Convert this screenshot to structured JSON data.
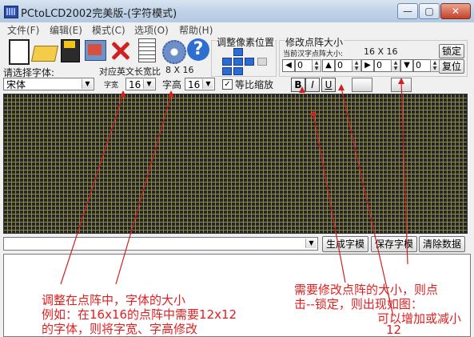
{
  "window": {
    "title": "PCtoLCD2002完美版-(字符模式)",
    "controls": {
      "minimize": "—",
      "maximize": "▢",
      "close": "✕"
    }
  },
  "menubar": {
    "items": [
      "文件(F)",
      "编辑(E)",
      "模式(C)",
      "选项(O)",
      "帮助(H)"
    ]
  },
  "toolbar": {
    "icons": [
      "new-file-icon",
      "open-folder-icon",
      "save-icon",
      "save-as-icon",
      "delete-icon",
      "document-icon",
      "settings-gear-icon",
      "help-icon"
    ]
  },
  "pixel_adjust": {
    "label": "调整像素位置"
  },
  "matrix_size": {
    "label": "修改点阵大小",
    "current_caption": "当前汉字点阵大小:",
    "current_value": "16 X 16",
    "lock_label": "锁定",
    "restore_label": "复位",
    "spinners": [
      "0",
      "0",
      "0",
      "0"
    ]
  },
  "font": {
    "select_label": "请选择字体:",
    "font_name": "宋体",
    "ascii_size_caption": "对应英文长宽比",
    "ascii_size_value": "8 X 16",
    "width_caption": "字宽",
    "width_value": "16",
    "height_caption": "字高",
    "height_value": "16",
    "proportional_label": "等比缩放",
    "proportional_checked": "✓"
  },
  "style_buttons": {
    "bold": "B",
    "italic": "I",
    "underline": "U"
  },
  "actions": {
    "generate": "生成字模",
    "save": "保存字模",
    "clear": "清除数据"
  },
  "annotations": {
    "color": "#e02020",
    "left_note_lines": [
      "调整在点阵中，字体的大小",
      "例如：在16x16的点阵中需要12x12",
      "的字体，则将字宽、字高修改"
    ],
    "right_note_lines": [
      "需要修改点阵的大小，则点",
      "击--锁定，则出现如图：",
      "可以增加或减小",
      "12"
    ]
  }
}
